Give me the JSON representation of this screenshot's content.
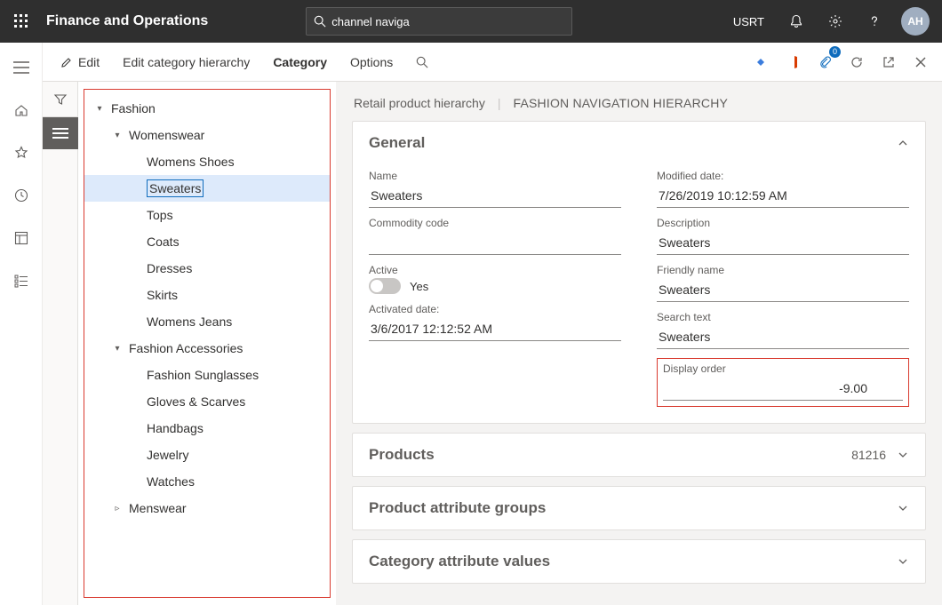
{
  "header": {
    "title": "Finance and Operations",
    "search_value": "channel naviga",
    "company": "USRT",
    "avatar_initials": "AH"
  },
  "actionbar": {
    "edit": "Edit",
    "edit_hierarchy": "Edit category hierarchy",
    "category": "Category",
    "options": "Options",
    "badge": "0"
  },
  "tree": {
    "root": "Fashion",
    "groups": [
      {
        "label": "Womenswear",
        "items": [
          "Womens Shoes",
          "Sweaters",
          "Tops",
          "Coats",
          "Dresses",
          "Skirts",
          "Womens Jeans"
        ],
        "expanded": true
      },
      {
        "label": "Fashion Accessories",
        "items": [
          "Fashion Sunglasses",
          "Gloves & Scarves",
          "Handbags",
          "Jewelry",
          "Watches"
        ],
        "expanded": true
      },
      {
        "label": "Menswear",
        "items": [],
        "expanded": false
      }
    ],
    "selected": "Sweaters"
  },
  "breadcrumb": {
    "parent": "Retail product hierarchy",
    "current": "FASHION NAVIGATION HIERARCHY"
  },
  "general": {
    "title": "General",
    "name_label": "Name",
    "name": "Sweaters",
    "commodity_label": "Commodity code",
    "commodity": "",
    "active_label": "Active",
    "active_text": "Yes",
    "activated_label": "Activated date:",
    "activated": "3/6/2017 12:12:52 AM",
    "modified_label": "Modified date:",
    "modified": "7/26/2019 10:12:59 AM",
    "description_label": "Description",
    "description": "Sweaters",
    "friendly_label": "Friendly name",
    "friendly": "Sweaters",
    "search_label": "Search text",
    "search": "Sweaters",
    "display_order_label": "Display order",
    "display_order": "-9.00"
  },
  "sections": {
    "products": {
      "title": "Products",
      "count": "81216"
    },
    "product_attribute_groups": {
      "title": "Product attribute groups"
    },
    "category_attribute_values": {
      "title": "Category attribute values"
    }
  }
}
